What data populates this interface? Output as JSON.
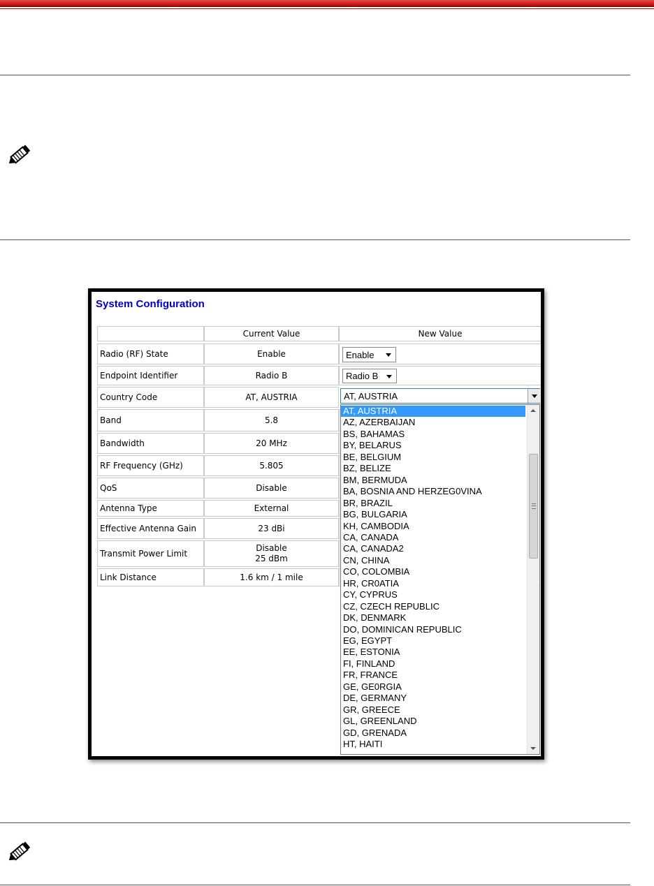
{
  "ui": {
    "title": "System Configuration",
    "headers": {
      "current": "Current Value",
      "new": "New Value"
    },
    "rows": [
      {
        "label": "Radio (RF) State",
        "current": "Enable",
        "new": "Enable"
      },
      {
        "label": "Endpoint Identifier",
        "current": "Radio B",
        "new": "Radio B"
      },
      {
        "label": "Country Code",
        "current": "AT, AUSTRIA",
        "new": "AT, AUSTRIA"
      },
      {
        "label": "Band",
        "current": "5.8"
      },
      {
        "label": "Bandwidth",
        "current": "20 MHz"
      },
      {
        "label": "RF Frequency (GHz)",
        "current": "5.805"
      },
      {
        "label": "QoS",
        "current": "Disable"
      },
      {
        "label": "Antenna Type",
        "current": "External"
      },
      {
        "label": "Effective Antenna Gain",
        "current": "23 dBi"
      },
      {
        "label": "Transmit Power Limit",
        "current": "Disable",
        "current2": "25 dBm"
      },
      {
        "label": "Link Distance",
        "current": "1.6 km / 1 mile"
      }
    ],
    "dropdown_options": [
      "AT, AUSTRIA",
      "AZ, AZERBAIJAN",
      "BS, BAHAMAS",
      "BY, BELARUS",
      "BE, BELGIUM",
      "BZ, BELIZE",
      "BM, BERMUDA",
      "BA, BOSNIA AND HERZEG0VINA",
      "BR, BRAZIL",
      "BG, BULGARIA",
      "KH, CAMBODIA",
      "CA, CANADA",
      "CA, CANADA2",
      "CN, CHINA",
      "CO, COLOMBIA",
      "HR, CR0ATIA",
      "CY, CYPRUS",
      "CZ, CZECH REPUBLIC",
      "DK, DENMARK",
      "DO, DOMINICAN REPUBLIC",
      "EG, EGYPT",
      "EE, ESTONIA",
      "FI, FINLAND",
      "FR, FRANCE",
      "GE, GE0RGIA",
      "DE, GERMANY",
      "GR, GREECE",
      "GL, GREENLAND",
      "GD, GRENADA",
      "HT, HAITI"
    ],
    "highlighted_index": 0
  },
  "colors": {
    "title": "#0000cc",
    "highlight": "#3399ff",
    "red_bar": "#c00000"
  },
  "icons": {
    "note": "pen-icon"
  }
}
